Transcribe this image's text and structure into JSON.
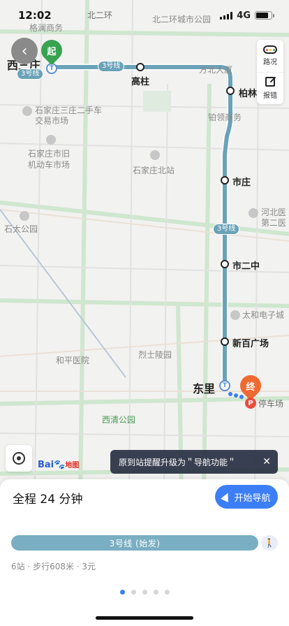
{
  "status": {
    "time": "12:02",
    "network": "4G"
  },
  "map": {
    "labels": {
      "beierhuan": "北二环",
      "gelan": "格澜商务",
      "beierhuan_park": "北二环城市公园",
      "sanzhuang_market_1": "石家庄三庄二手车",
      "sanzhuang_market_2": "交易市场",
      "jiufu_1": "石家庄市旧",
      "jiufu_2": "机动车市场",
      "north_station": "石家庄北站",
      "shitai_park": "石太公园",
      "hebei_1": "河北医",
      "hebei_2": "第二医",
      "heping_hospital": "和平医院",
      "lieshi_cemetery": "烈士陵园",
      "taihe": "太和电子城",
      "xiqing_park": "西清公园",
      "parking_lot": "停车场",
      "zhongling": "铂领商务",
      "fangbei": "方北大厦"
    },
    "stations": {
      "xisanzhuang": "西三庄",
      "gaozhu": "高柱",
      "bolin": "柏林",
      "shizhuang": "市庄",
      "shierzhong": "市二中",
      "xinbai": "新百广场",
      "dongli": "东里"
    },
    "line_tags": {
      "tag1": "3号线",
      "tag2": "3号线",
      "tag3": "3号线"
    },
    "pins": {
      "start": "起",
      "end": "终"
    }
  },
  "controls": {
    "traffic_label": "路况",
    "report_label": "报错",
    "logo_brand": "Bai",
    "logo_suffix": "地图"
  },
  "toast": {
    "text": "原到站提醒升级为＂导航功能＂",
    "close": "✕"
  },
  "sheet": {
    "title": "全程 24 分钟",
    "nav_button": "开始导航",
    "route_bar": "3号线 (始发)",
    "info": "6站 · 步行608米 · 3元",
    "pages": 5,
    "active_page": 1
  },
  "colors": {
    "line": "#7aaec2",
    "accent": "#3c7ef5",
    "start": "#37a350",
    "end": "#ef6a32"
  }
}
